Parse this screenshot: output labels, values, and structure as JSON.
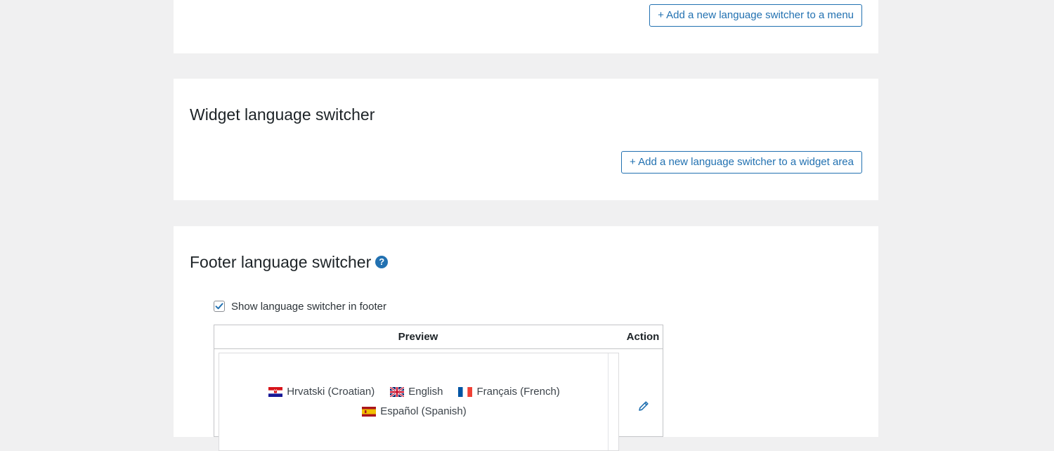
{
  "menu_section": {
    "add_button_label": "+ Add a new language switcher to a menu"
  },
  "widget_section": {
    "title": "Widget language switcher",
    "add_button_label": "+ Add a new language switcher to a widget area"
  },
  "footer_section": {
    "title": "Footer language switcher",
    "help_icon": "question-mark-icon",
    "checkbox": {
      "label": "Show language switcher in footer",
      "checked": true
    },
    "table": {
      "headers": [
        "Preview",
        "Action"
      ],
      "languages": [
        {
          "label": "Hrvatski (Croatian)",
          "flag": "croatia-flag"
        },
        {
          "label": "English",
          "flag": "uk-flag"
        },
        {
          "label": "Français (French)",
          "flag": "france-flag"
        },
        {
          "label": "Español (Spanish)",
          "flag": "spain-flag"
        }
      ],
      "action_icon": "pencil-icon"
    }
  },
  "colors": {
    "accent": "#2271b1",
    "page_background": "#f0f0f1",
    "card_background": "#ffffff",
    "text": "#1d2327"
  }
}
